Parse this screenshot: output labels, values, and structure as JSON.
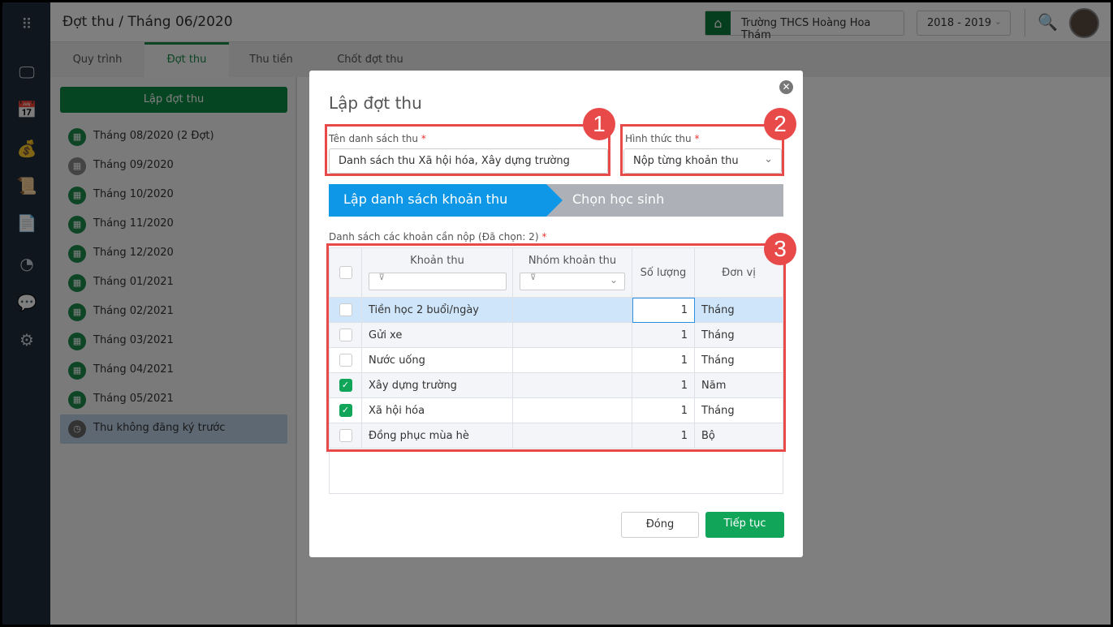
{
  "header": {
    "title": "Đợt thu / Tháng 06/2020",
    "school": "Trường THCS Hoàng Hoa Thám",
    "year": "2018 - 2019"
  },
  "tabs": [
    "Quy trình",
    "Đợt thu",
    "Thu tiền",
    "Chốt đợt thu"
  ],
  "left": {
    "create_label": "Lập đợt thu",
    "months": [
      "Tháng 08/2020 (2 Đợt)",
      "Tháng 09/2020",
      "Tháng 10/2020",
      "Tháng 11/2020",
      "Tháng 12/2020",
      "Tháng 01/2021",
      "Tháng 02/2021",
      "Tháng 03/2021",
      "Tháng 04/2021",
      "Tháng 05/2021"
    ],
    "other": "Thu không đăng ký trước"
  },
  "modal": {
    "title": "Lập đợt thu",
    "name_label": "Tên danh sách thu",
    "name_value": "Danh sách thu Xã hội hóa, Xây dựng trường",
    "method_label": "Hình thức thu",
    "method_value": "Nộp từng khoản thu",
    "required_mark": "*",
    "step1": "Lập danh sách khoản thu",
    "step2": "Chọn học sinh",
    "list_label": "Danh sách các khoản cần nộp (Đã chọn: 2)",
    "columns": [
      "Khoản thu",
      "Nhóm khoản thu",
      "Số lượng",
      "Đơn vị"
    ],
    "rows": [
      {
        "name": "Tiền học 2 buổi/ngày",
        "group": "",
        "qty": "1",
        "unit": "Tháng",
        "checked": false
      },
      {
        "name": "Gửi xe",
        "group": "",
        "qty": "1",
        "unit": "Tháng",
        "checked": false
      },
      {
        "name": "Nước uống",
        "group": "",
        "qty": "1",
        "unit": "Tháng",
        "checked": false
      },
      {
        "name": "Xây dựng trường",
        "group": "",
        "qty": "1",
        "unit": "Năm",
        "checked": true
      },
      {
        "name": "Xã hội hóa",
        "group": "",
        "qty": "1",
        "unit": "Tháng",
        "checked": true
      },
      {
        "name": "Đồng phục mùa hè",
        "group": "",
        "qty": "1",
        "unit": "Bộ",
        "checked": false
      }
    ],
    "close_label": "Đóng",
    "continue_label": "Tiếp tục"
  },
  "annotations": [
    "1",
    "2",
    "3"
  ],
  "colors": {
    "brand": "#0a8a45",
    "step_active": "#0d97e6",
    "annotation": "#e84a4a"
  }
}
